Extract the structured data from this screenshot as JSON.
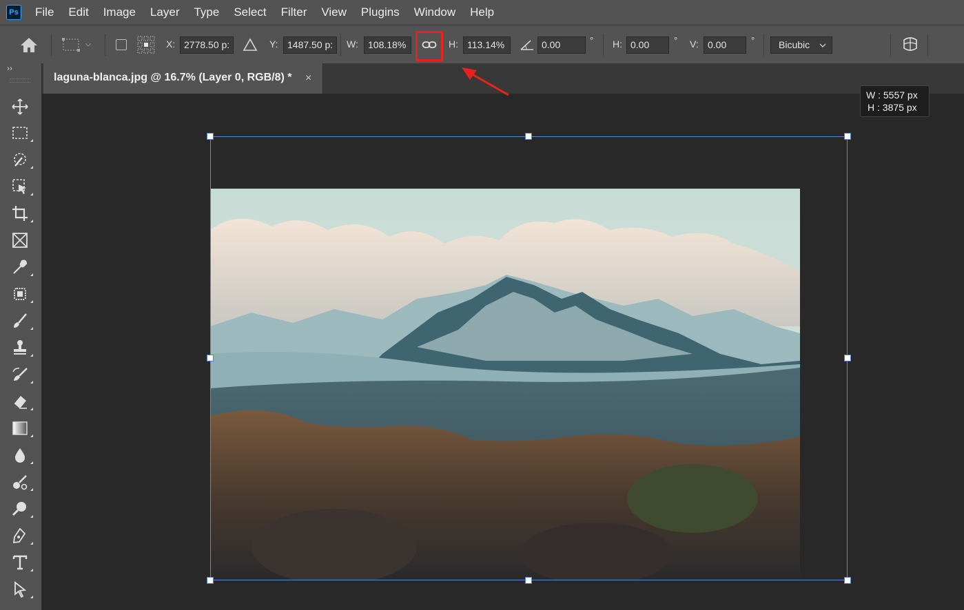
{
  "app": {
    "logo_text": "Ps"
  },
  "menu": [
    "File",
    "Edit",
    "Image",
    "Layer",
    "Type",
    "Select",
    "Filter",
    "View",
    "Plugins",
    "Window",
    "Help"
  ],
  "options_bar": {
    "x_label": "X:",
    "x_value": "2778.50 p:",
    "y_label": "Y:",
    "y_value": "1487.50 p:",
    "w_label": "W:",
    "w_value": "108.18%",
    "h_label": "H:",
    "h_value": "113.14%",
    "angle_value": "0.00",
    "angle_unit": "°",
    "skew_h_label": "H:",
    "skew_h_value": "0.00",
    "skew_h_unit": "°",
    "skew_v_label": "V:",
    "skew_v_value": "0.00",
    "skew_v_unit": "°",
    "interpolation": "Bicubic"
  },
  "document_tab": {
    "title": "laguna-blanca.jpg @ 16.7% (Layer 0, RGB/8) *",
    "close": "×"
  },
  "panel_collapse": "››",
  "dimensions_tooltip": {
    "w": "W :  5557 px",
    "h": "H :  3875 px"
  },
  "annotation": {
    "color": "#e8231b"
  },
  "tools": [
    "move-tool",
    "marquee-tool",
    "quick-selection-tool",
    "object-selection-tool",
    "crop-tool",
    "frame-tool",
    "eyedropper-tool",
    "spot-healing-tool",
    "brush-tool",
    "clone-stamp-tool",
    "history-brush-tool",
    "eraser-tool",
    "gradient-tool",
    "blur-tool",
    "dodge-tool",
    "zoom-tool",
    "pen-tool",
    "type-tool",
    "path-selection-tool"
  ]
}
